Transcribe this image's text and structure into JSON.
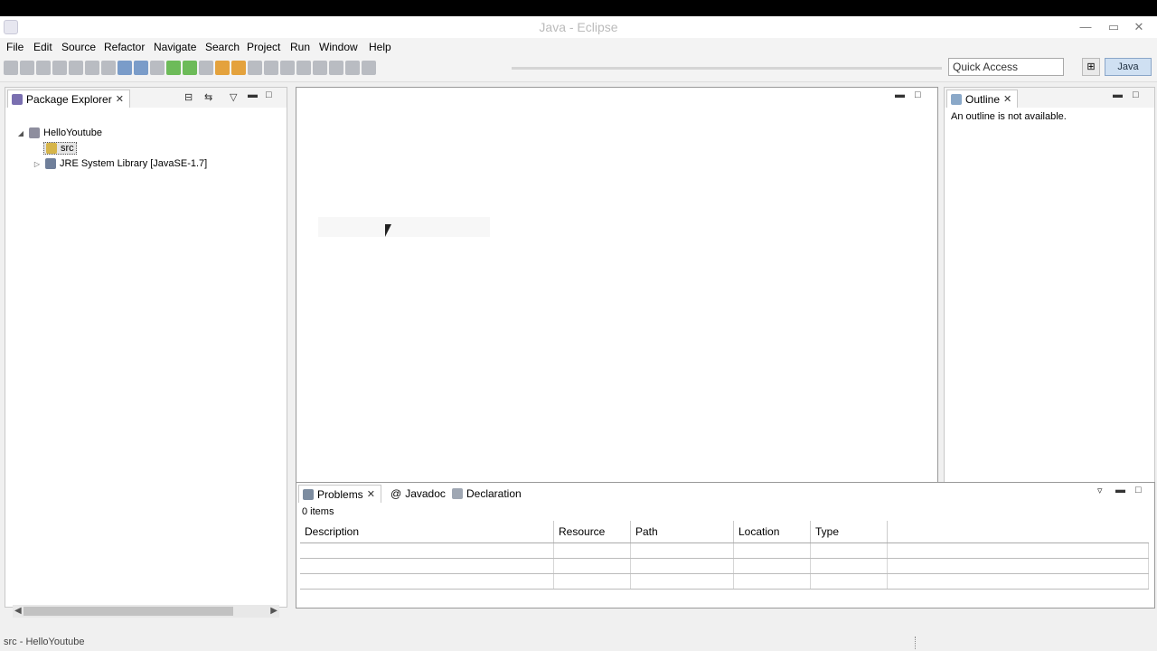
{
  "window": {
    "title": "Java - Eclipse"
  },
  "menu": [
    "File",
    "Edit",
    "Source",
    "Refactor",
    "Navigate",
    "Search",
    "Project",
    "Run",
    "Window",
    "Help"
  ],
  "toolbar": {
    "quick_access": "Quick Access",
    "perspective": "Java"
  },
  "package_explorer": {
    "tab": "Package Explorer",
    "project": "HelloYoutube",
    "src": "src",
    "library": "JRE System Library [JavaSE-1.7]"
  },
  "outline": {
    "tab": "Outline",
    "message": "An outline is not available."
  },
  "bottom": {
    "tabs": [
      "Problems",
      "Javadoc",
      "Declaration"
    ],
    "count": "0 items",
    "columns": [
      "Description",
      "Resource",
      "Path",
      "Location",
      "Type"
    ]
  },
  "status": {
    "text": "src - HelloYoutube"
  }
}
